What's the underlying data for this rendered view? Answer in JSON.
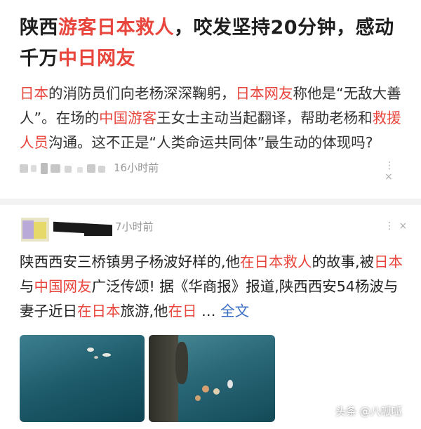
{
  "post1": {
    "title_segments": [
      {
        "text": "陕西",
        "hl": false
      },
      {
        "text": "游客日本救人",
        "hl": true
      },
      {
        "text": "，咬发坚持20分钟，感动千万",
        "hl": false
      },
      {
        "text": "中日网友",
        "hl": true
      }
    ],
    "excerpt_segments": [
      {
        "text": "日本",
        "hl": true
      },
      {
        "text": "的消防员们向老杨深深鞠躬，",
        "hl": false
      },
      {
        "text": "日本网友",
        "hl": true
      },
      {
        "text": "称他是“无敌大善人”。在场的",
        "hl": false
      },
      {
        "text": "中国游客",
        "hl": true
      },
      {
        "text": "王女士主动当起翻译，帮助老杨和",
        "hl": false
      },
      {
        "text": "救援人员",
        "hl": true
      },
      {
        "text": "沟通。这不正是“人类命运共同体”最生动的体现吗?",
        "hl": false
      }
    ],
    "time": "16小时前",
    "more_icon": "more-dots-icon"
  },
  "post2": {
    "time": "7小时前",
    "body_segments": [
      {
        "text": "陕西西安三桥镇男子杨波好样的,他",
        "hl": false
      },
      {
        "text": "在日本救人",
        "hl": true
      },
      {
        "text": "的故事,被",
        "hl": false
      },
      {
        "text": "日本",
        "hl": true
      },
      {
        "text": "与",
        "hl": false
      },
      {
        "text": "中国网友",
        "hl": true
      },
      {
        "text": "广泛传颂! 据《华商报》报道,陕西西安54杨波与妻子近日",
        "hl": false
      },
      {
        "text": "在日本",
        "hl": true
      },
      {
        "text": "旅游,他",
        "hl": false
      },
      {
        "text": "在日",
        "hl": true
      }
    ],
    "ellipsis": " …",
    "full_text": "全文",
    "more_icon": "more-dots-icon"
  },
  "watermark": "头条 @八呱呱",
  "colors": {
    "highlight": "#e8453c",
    "link": "#3a6fc4",
    "meta": "#999999"
  }
}
